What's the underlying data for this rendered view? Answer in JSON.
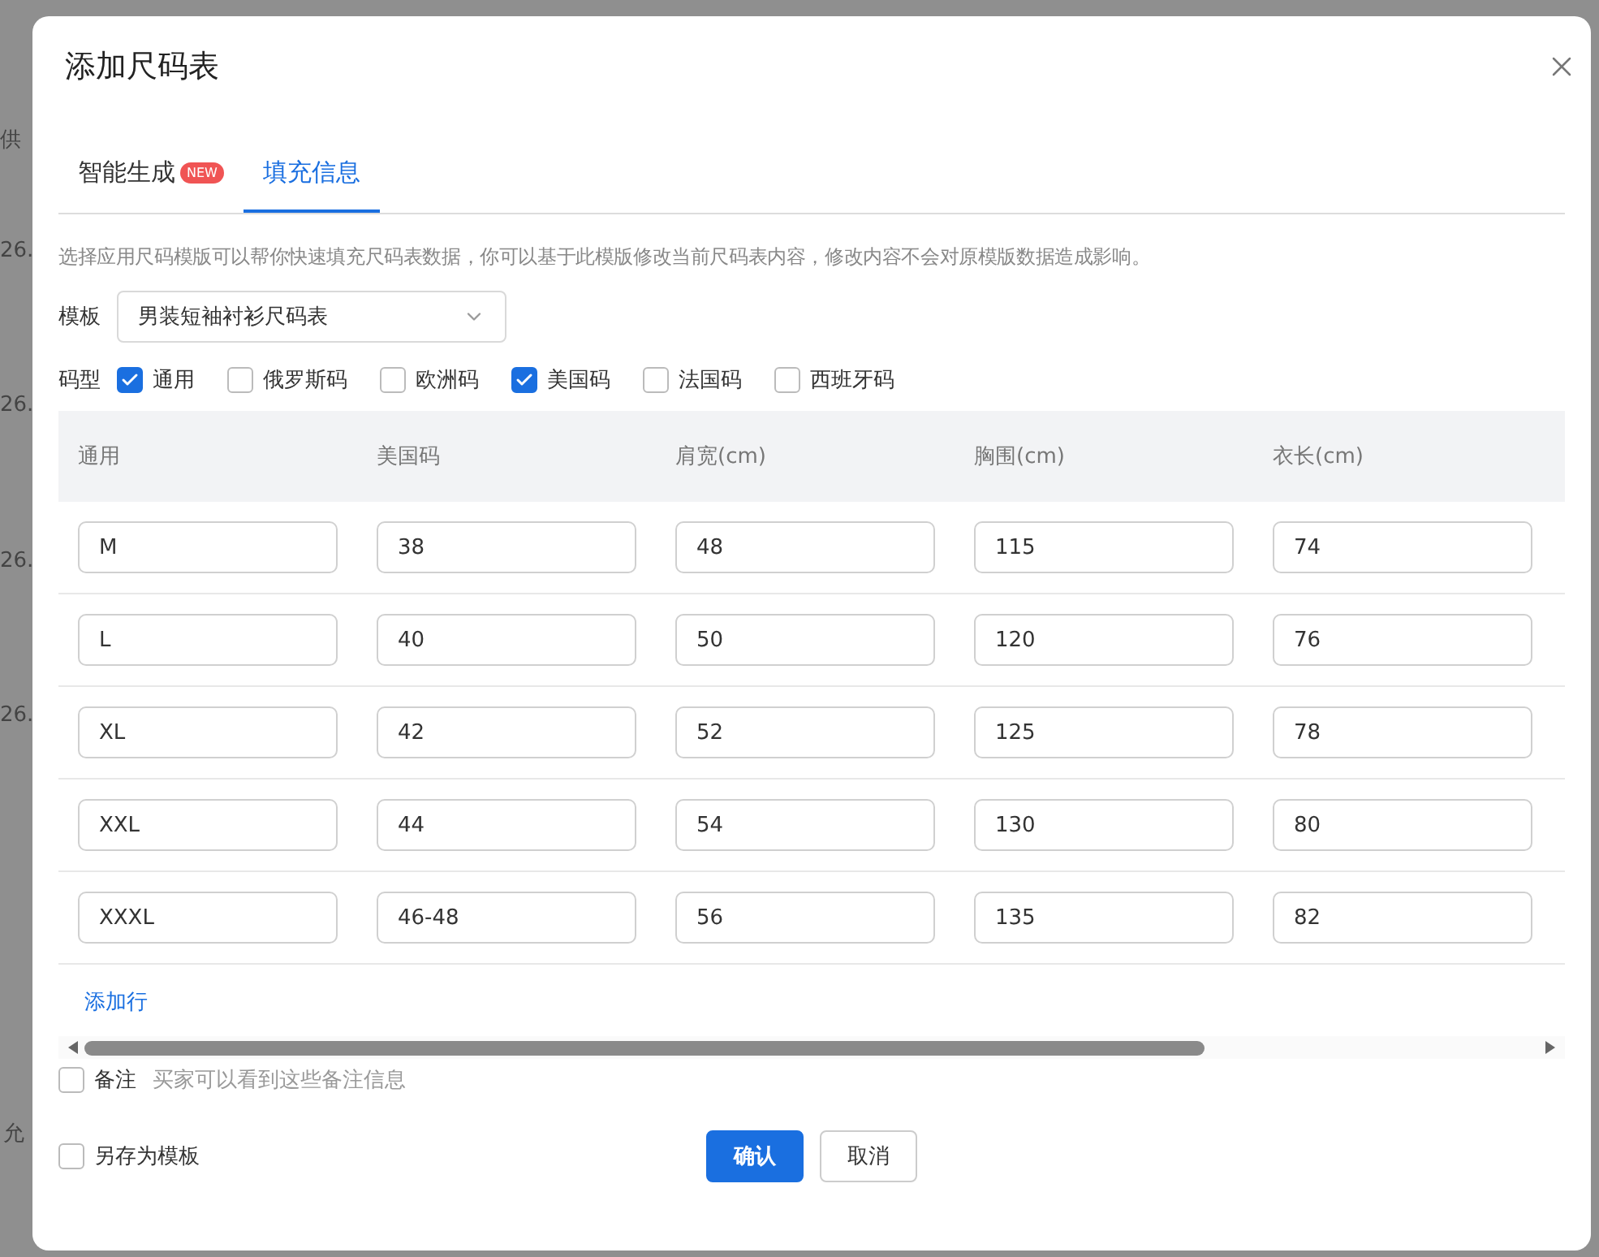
{
  "background": {
    "texts": [
      "供",
      "26.",
      "26.",
      "26.",
      "26.",
      "允"
    ]
  },
  "dialog": {
    "title": "添加尺码表",
    "tabs": [
      {
        "label": "智能生成",
        "badge": "NEW",
        "selected": false
      },
      {
        "label": "填充信息",
        "selected": true
      }
    ],
    "description": "选择应用尺码模版可以帮你快速填充尺码表数据，你可以基于此模版修改当前尺码表内容，修改内容不会对原模版数据造成影响。",
    "template": {
      "label": "模板",
      "value": "男装短袖衬衫尺码表"
    },
    "size_types": {
      "label": "码型",
      "options": [
        {
          "label": "通用",
          "checked": true
        },
        {
          "label": "俄罗斯码",
          "checked": false
        },
        {
          "label": "欧洲码",
          "checked": false
        },
        {
          "label": "美国码",
          "checked": true
        },
        {
          "label": "法国码",
          "checked": false
        },
        {
          "label": "西班牙码",
          "checked": false
        }
      ]
    },
    "table": {
      "columns": [
        "通用",
        "美国码",
        "肩宽(cm)",
        "胸围(cm)",
        "衣长(cm)"
      ],
      "rows": [
        [
          "M",
          "38",
          "48",
          "115",
          "74"
        ],
        [
          "L",
          "40",
          "50",
          "120",
          "76"
        ],
        [
          "XL",
          "42",
          "52",
          "125",
          "78"
        ],
        [
          "XXL",
          "44",
          "54",
          "130",
          "80"
        ],
        [
          "XXXL",
          "46-48",
          "56",
          "135",
          "82"
        ]
      ]
    },
    "add_row": "添加行",
    "remark": {
      "label": "备注",
      "hint": "买家可以看到这些备注信息",
      "checked": false
    },
    "save_as_template": {
      "label": "另存为模板",
      "checked": false
    },
    "buttons": [
      {
        "label": "确认",
        "kind": "primary"
      },
      {
        "label": "取消",
        "kind": "default"
      }
    ]
  }
}
